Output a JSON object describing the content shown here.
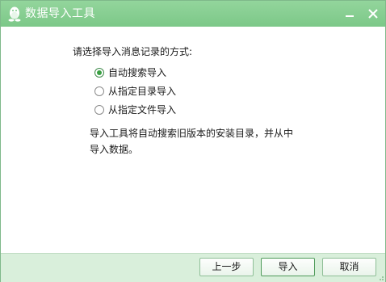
{
  "window": {
    "title": "数据导入工具",
    "icon": "qq-penguin-icon"
  },
  "title_buttons": {
    "minimize_icon": "minimize-icon",
    "close_icon": "close-icon"
  },
  "colors": {
    "titlebar": "#86cf92",
    "footer": "#d9efdb",
    "accent": "#3aa043"
  },
  "main": {
    "prompt": "请选择导入消息记录的方式:",
    "options": [
      {
        "label": "自动搜索导入",
        "checked": true
      },
      {
        "label": "从指定目录导入",
        "checked": false
      },
      {
        "label": "从指定文件导入",
        "checked": false
      }
    ],
    "description_line1": "导入工具将自动搜索旧版本的安装目录，并从中",
    "description_line2": "导入数据。"
  },
  "footer": {
    "prev_label": "上一步",
    "import_label": "导入",
    "cancel_label": "取消"
  }
}
